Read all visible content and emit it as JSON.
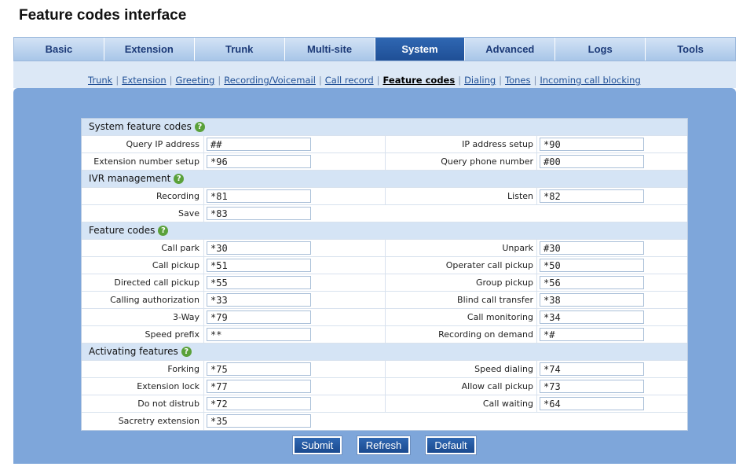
{
  "page": {
    "title": "Feature codes interface"
  },
  "main_tabs": [
    "Basic",
    "Extension",
    "Trunk",
    "Multi-site",
    "System",
    "Advanced",
    "Logs",
    "Tools"
  ],
  "active_main_tab": "System",
  "sub_nav": [
    "Trunk",
    "Extension",
    "Greeting",
    "Recording/Voicemail",
    "Call record",
    "Feature codes",
    "Dialing",
    "Tones",
    "Incoming call blocking"
  ],
  "active_sub_nav": "Feature codes",
  "sections": [
    {
      "title": "System feature codes",
      "rows": [
        [
          {
            "label": "Query IP address",
            "value": "##"
          },
          {
            "label": "IP address setup",
            "value": "*90"
          }
        ],
        [
          {
            "label": "Extension number setup",
            "value": "*96"
          },
          {
            "label": "Query phone number",
            "value": "#00"
          }
        ]
      ]
    },
    {
      "title": "IVR management",
      "rows": [
        [
          {
            "label": "Recording",
            "value": "*81"
          },
          {
            "label": "Listen",
            "value": "*82"
          }
        ],
        [
          {
            "label": "Save",
            "value": "*83"
          }
        ]
      ]
    },
    {
      "title": "Feature codes",
      "rows": [
        [
          {
            "label": "Call park",
            "value": "*30"
          },
          {
            "label": "Unpark",
            "value": "#30"
          }
        ],
        [
          {
            "label": "Call pickup",
            "value": "*51"
          },
          {
            "label": "Operater call pickup",
            "value": "*50"
          }
        ],
        [
          {
            "label": "Directed call pickup",
            "value": "*55"
          },
          {
            "label": "Group pickup",
            "value": "*56"
          }
        ],
        [
          {
            "label": "Calling authorization",
            "value": "*33"
          },
          {
            "label": "Blind call transfer",
            "value": "*38"
          }
        ],
        [
          {
            "label": "3-Way",
            "value": "*79"
          },
          {
            "label": "Call monitoring",
            "value": "*34"
          }
        ],
        [
          {
            "label": "Speed prefix",
            "value": "**"
          },
          {
            "label": "Recording on demand",
            "value": "*#"
          }
        ]
      ]
    },
    {
      "title": "Activating features",
      "rows": [
        [
          {
            "label": "Forking",
            "value": "*75"
          },
          {
            "label": "Speed dialing",
            "value": "*74"
          }
        ],
        [
          {
            "label": "Extension lock",
            "value": "*77"
          },
          {
            "label": "Allow call pickup",
            "value": "*73"
          }
        ],
        [
          {
            "label": "Do not distrub",
            "value": "*72"
          },
          {
            "label": "Call waiting",
            "value": "*64"
          }
        ],
        [
          {
            "label": "Sacretry extension",
            "value": "*35"
          }
        ]
      ]
    }
  ],
  "buttons": {
    "submit": "Submit",
    "refresh": "Refresh",
    "default": "Default"
  },
  "colors": {
    "nav_active": "#2f67b2",
    "panel": "#7ea6da",
    "section_band": "#d5e4f5",
    "help_icon": "#5aa13a"
  },
  "icons": {
    "help": "help-icon"
  }
}
